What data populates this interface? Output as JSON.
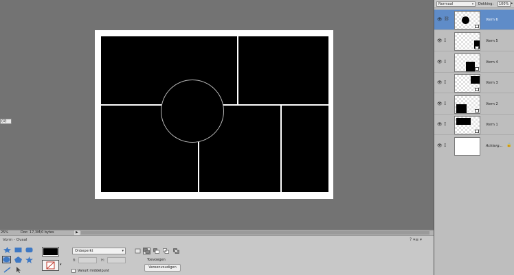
{
  "workspace": {
    "side_tag": "(U)"
  },
  "status": {
    "zoom": "25%",
    "doc_info": "Doc: 17,3M/0 bytes",
    "arrow": "▶"
  },
  "options": {
    "tool_title": "Vorm - Ovaal",
    "help_icons": "? ▾≡ ▾",
    "style_dropdown": "Onbeperkt",
    "width_label": "B:",
    "height_label": "H:",
    "from_center_label": "Vanuit middelpunt",
    "combine_mode_label": "Toevoegen",
    "simplify_button": "Vereenvoudigen",
    "shape_icons": [
      "custom-shape-icon",
      "rectangle-icon",
      "rounded-rectangle-icon",
      "ellipse-icon",
      "polygon-icon",
      "star-icon",
      "line-icon",
      "selection-arrow-icon"
    ],
    "selected_shape": "ellipse-icon"
  },
  "layers_panel": {
    "blend_mode": "Normaal",
    "opacity_label": "Dekking:",
    "opacity_value": "100%",
    "layers": [
      {
        "name": "Vorm 6",
        "active": true,
        "visible": true
      },
      {
        "name": "Vorm 5",
        "active": false,
        "visible": true
      },
      {
        "name": "Vorm 4",
        "active": false,
        "visible": true
      },
      {
        "name": "Vorm 3",
        "active": false,
        "visible": true
      },
      {
        "name": "Vorm 2",
        "active": false,
        "visible": true
      },
      {
        "name": "Vorm 1",
        "active": false,
        "visible": true
      },
      {
        "name": "Achterg...",
        "active": false,
        "visible": true,
        "locked": true
      }
    ]
  },
  "colors": {
    "panel_selection": "#5f8cc8",
    "canvas_background": "#737373",
    "shape_fill": "#000000"
  }
}
